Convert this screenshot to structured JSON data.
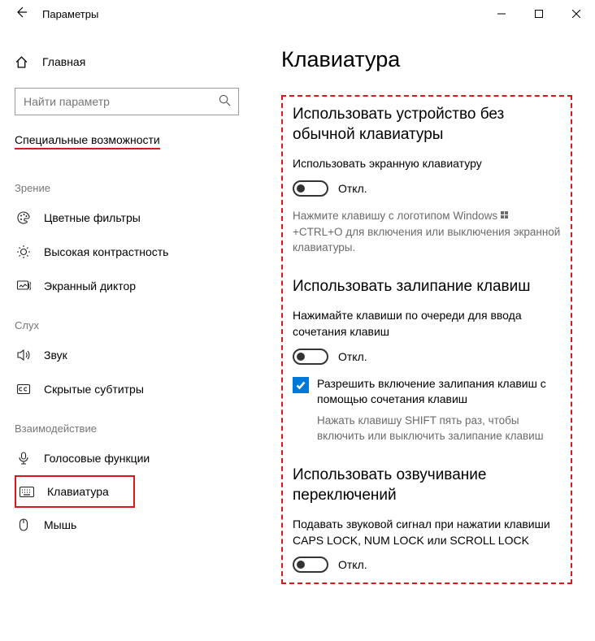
{
  "window": {
    "title": "Параметры"
  },
  "sidebar": {
    "home": "Главная",
    "search_placeholder": "Найти параметр",
    "section": "Специальные возможности",
    "categories": {
      "vision": "Зрение",
      "hearing": "Слух",
      "interaction": "Взаимодействие"
    },
    "items": {
      "color_filters": "Цветные фильтры",
      "high_contrast": "Высокая контрастность",
      "narrator": "Экранный диктор",
      "sound": "Звук",
      "closed_captions": "Скрытые субтитры",
      "speech": "Голосовые функции",
      "keyboard": "Клавиатура",
      "mouse": "Мышь"
    }
  },
  "content": {
    "page_title": "Клавиатура",
    "section1": {
      "heading": "Использовать устройство без обычной клавиатуры",
      "osk_label": "Использовать экранную клавиатуру",
      "off": "Откл.",
      "hint_prefix": "Нажмите клавишу с логотипом Windows ",
      "hint_suffix": " +CTRL+O для включения или выключения экранной клавиатуры."
    },
    "section2": {
      "heading": "Использовать залипание клавиш",
      "label": "Нажимайте клавиши по очереди для ввода сочетания клавиш",
      "off": "Откл.",
      "checkbox_label": "Разрешить включение залипания клавиш с помощью сочетания клавиш",
      "checkbox_hint": "Нажать клавишу SHIFT пять раз, чтобы включить или выключить залипание клавиш"
    },
    "section3": {
      "heading": "Использовать озвучивание переключений",
      "label": "Подавать звуковой сигнал при нажатии клавиши CAPS LOCK, NUM LOCK или SCROLL LOCK",
      "off": "Откл."
    }
  }
}
